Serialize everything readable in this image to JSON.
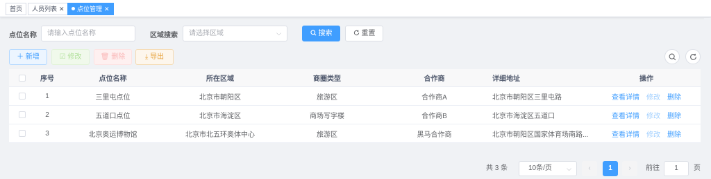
{
  "tags": [
    {
      "label": "首页",
      "closable": false
    },
    {
      "label": "人员列表",
      "closable": true
    },
    {
      "label": "点位管理",
      "closable": true,
      "active": true
    }
  ],
  "search": {
    "name_label": "点位名称",
    "name_placeholder": "请输入点位名称",
    "area_label": "区域搜索",
    "area_placeholder": "请选择区域",
    "search_button": "搜索",
    "reset_button": "重置"
  },
  "toolbar": {
    "add": "新增",
    "edit": "修改",
    "delete": "删除",
    "export": "导出"
  },
  "table": {
    "headers": [
      "序号",
      "点位名称",
      "所在区域",
      "商圈类型",
      "合作商",
      "详细地址",
      "操作"
    ],
    "rows": [
      {
        "index": "1",
        "name": "三里屯点位",
        "area": "北京市朝阳区",
        "type": "旅游区",
        "partner": "合作商A",
        "address": "北京市朝阳区三里屯路"
      },
      {
        "index": "2",
        "name": "五道口点位",
        "area": "北京市海淀区",
        "type": "商场写字楼",
        "partner": "合作商B",
        "address": "北京市海淀区五道口"
      },
      {
        "index": "3",
        "name": "北京奥运博物馆",
        "area": "北京市北五环奥体中心",
        "type": "旅游区",
        "partner": "黑马合作商",
        "address": "北京市朝阳区国家体育场南路..."
      }
    ],
    "actions": {
      "detail": "查看详情",
      "edit": "修改",
      "delete": "删除"
    }
  },
  "pagination": {
    "total": "共 3 条",
    "page_size": "10条/页",
    "current_page": "1",
    "goto_label": "前往",
    "goto_value": "1",
    "page_unit": "页"
  },
  "colors": {
    "primary": "#409eff"
  }
}
